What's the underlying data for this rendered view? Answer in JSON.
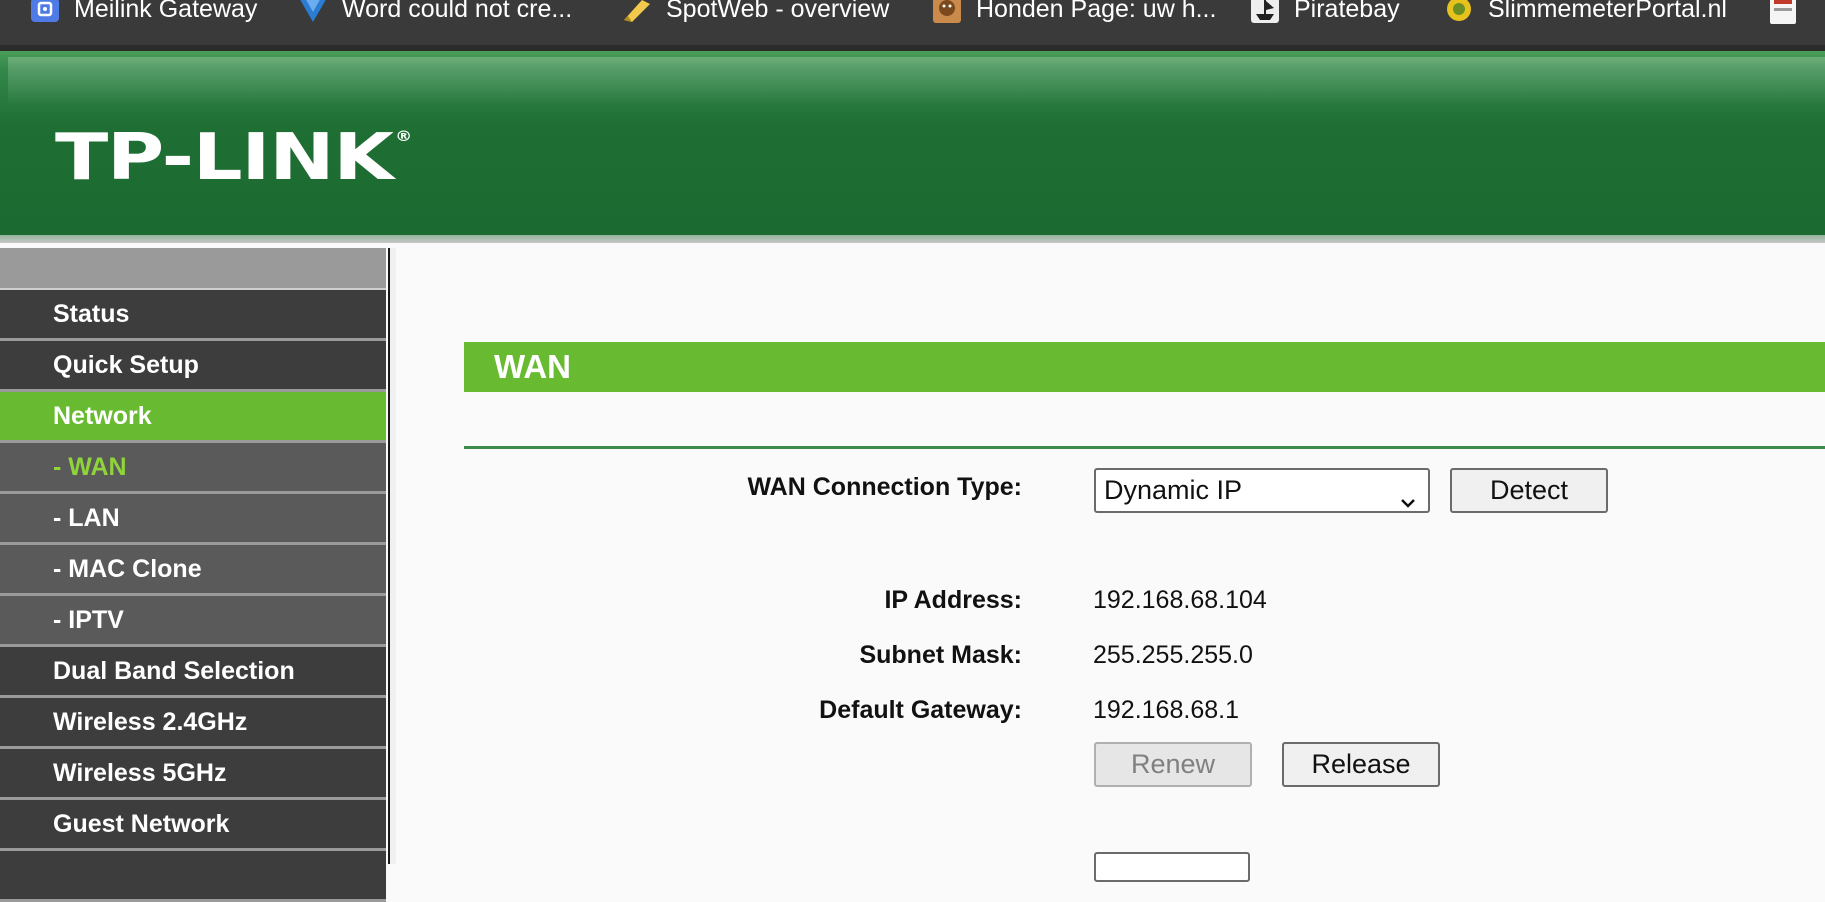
{
  "bookmarks": [
    {
      "label": "Meilink Gateway",
      "icon": "gateway-icon"
    },
    {
      "label": "Word could not cre...",
      "icon": "word-doc-icon"
    },
    {
      "label": "SpotWeb - overview",
      "icon": "spotweb-icon"
    },
    {
      "label": "Honden Page: uw h...",
      "icon": "dog-icon"
    },
    {
      "label": "Piratebay",
      "icon": "pirate-ship-icon"
    },
    {
      "label": "SlimmemeterPortal.nl",
      "icon": "meter-icon"
    }
  ],
  "header": {
    "logo_text": "TP-LINK",
    "logo_mark": "®"
  },
  "sidebar": {
    "items": [
      {
        "label": "Status",
        "type": "main"
      },
      {
        "label": "Quick Setup",
        "type": "main"
      },
      {
        "label": "Network",
        "type": "active"
      },
      {
        "label": "- WAN",
        "type": "current"
      },
      {
        "label": "- LAN",
        "type": "sub"
      },
      {
        "label": "- MAC Clone",
        "type": "sub"
      },
      {
        "label": "- IPTV",
        "type": "sub"
      },
      {
        "label": "Dual Band Selection",
        "type": "main"
      },
      {
        "label": "Wireless 2.4GHz",
        "type": "main"
      },
      {
        "label": "Wireless 5GHz",
        "type": "main"
      },
      {
        "label": "Guest Network",
        "type": "main"
      }
    ]
  },
  "main": {
    "section_title": "WAN",
    "connection_type": {
      "label": "WAN Connection Type:",
      "selected": "Dynamic IP",
      "detect_label": "Detect"
    },
    "fields": [
      {
        "label": "IP Address:",
        "value": "192.168.68.104"
      },
      {
        "label": "Subnet Mask:",
        "value": "255.255.255.0"
      },
      {
        "label": "Default Gateway:",
        "value": "192.168.68.1"
      }
    ],
    "renew_label": "Renew",
    "release_label": "Release"
  },
  "colors": {
    "accent_green": "#68bb31",
    "header_green": "#1f6f34",
    "sidebar_dark": "#3d3d3d",
    "current_item": "#8fd43a"
  }
}
